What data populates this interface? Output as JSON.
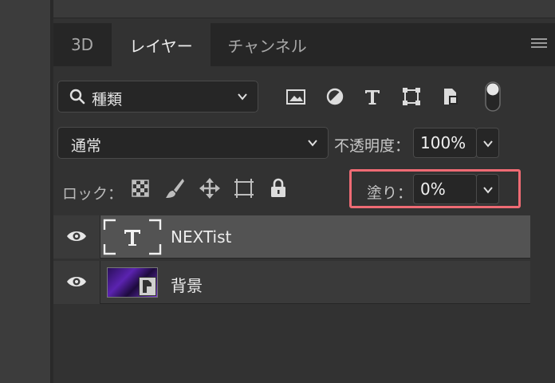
{
  "tabs": [
    {
      "label": "3D"
    },
    {
      "label": "レイヤー"
    },
    {
      "label": "チャンネル"
    }
  ],
  "filter": {
    "label": "種類"
  },
  "blend": {
    "mode": "通常"
  },
  "opacity": {
    "label": "不透明度：",
    "value": "100%"
  },
  "lock": {
    "label": "ロック："
  },
  "fill": {
    "label": "塗り：",
    "value": "0%"
  },
  "layers": [
    {
      "name": "NEXTist",
      "type": "text"
    },
    {
      "name": "背景",
      "type": "smart-object"
    }
  ],
  "colors": {
    "highlight": "#ef6b74",
    "selected_row": "#535353",
    "panel_bg": "#323232"
  }
}
